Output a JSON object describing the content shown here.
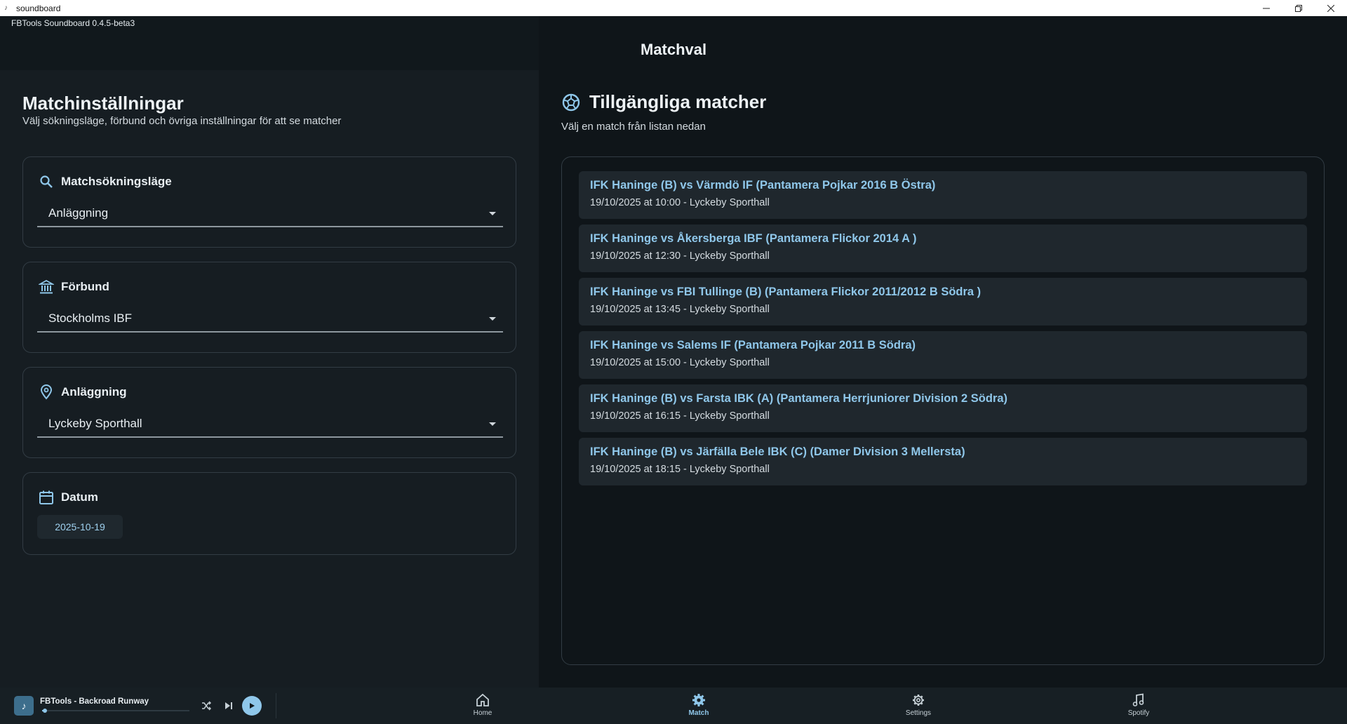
{
  "window": {
    "title": "soundboard",
    "controls": [
      "minimize",
      "restore",
      "close"
    ]
  },
  "app": {
    "version_label": "FBTools Soundboard 0.4.5-beta3",
    "page_title": "Matchval"
  },
  "settings": {
    "heading": "Matchinställningar",
    "subtitle": "Välj sökningsläge, förbund och övriga inställningar för att se matcher",
    "search_mode": {
      "label": "Matchsökningsläge",
      "value": "Anläggning",
      "icon": "search-icon"
    },
    "association": {
      "label": "Förbund",
      "value": "Stockholms IBF",
      "icon": "bank-icon"
    },
    "venue": {
      "label": "Anläggning",
      "value": "Lyckeby Sporthall",
      "icon": "location-pin-icon"
    },
    "date": {
      "label": "Datum",
      "value": "2025-10-19",
      "icon": "calendar-icon"
    }
  },
  "matches": {
    "heading": "Tillgängliga matcher",
    "subtitle": "Välj en match från listan nedan",
    "icon": "soccer-ball-icon",
    "items": [
      {
        "title": "IFK Haninge (B) vs Värmdö IF (Pantamera Pojkar 2016 B Östra)",
        "details": "19/10/2025 at 10:00 - Lyckeby Sporthall"
      },
      {
        "title": "IFK Haninge  vs Åkersberga IBF (Pantamera Flickor 2014 A )",
        "details": "19/10/2025 at 12:30 - Lyckeby Sporthall"
      },
      {
        "title": "IFK Haninge  vs FBI Tullinge (B) (Pantamera Flickor 2011/2012 B Södra )",
        "details": "19/10/2025 at 13:45 - Lyckeby Sporthall"
      },
      {
        "title": "IFK Haninge  vs Salems IF (Pantamera Pojkar 2011 B Södra)",
        "details": "19/10/2025 at 15:00 - Lyckeby Sporthall"
      },
      {
        "title": "IFK Haninge (B) vs Farsta IBK (A) (Pantamera Herrjuniorer Division 2 Södra)",
        "details": "19/10/2025 at 16:15 - Lyckeby Sporthall"
      },
      {
        "title": "IFK Haninge (B) vs Järfälla Bele IBK (C) (Damer Division 3 Mellersta)",
        "details": "19/10/2025 at 18:15 - Lyckeby Sporthall"
      }
    ]
  },
  "player": {
    "track": "FBTools - Backroad Runway",
    "progress": 0.02
  },
  "nav": {
    "items": [
      {
        "label": "Home",
        "icon": "home-icon",
        "active": false
      },
      {
        "label": "Match",
        "icon": "gear-icon",
        "active": true
      },
      {
        "label": "Settings",
        "icon": "gear-icon",
        "active": false
      },
      {
        "label": "Spotify",
        "icon": "music-note-icon",
        "active": false
      }
    ]
  },
  "colors": {
    "accent": "#8fc7ea",
    "background": "#0f1519",
    "panel": "#161d22",
    "card_item": "#1f272d"
  }
}
